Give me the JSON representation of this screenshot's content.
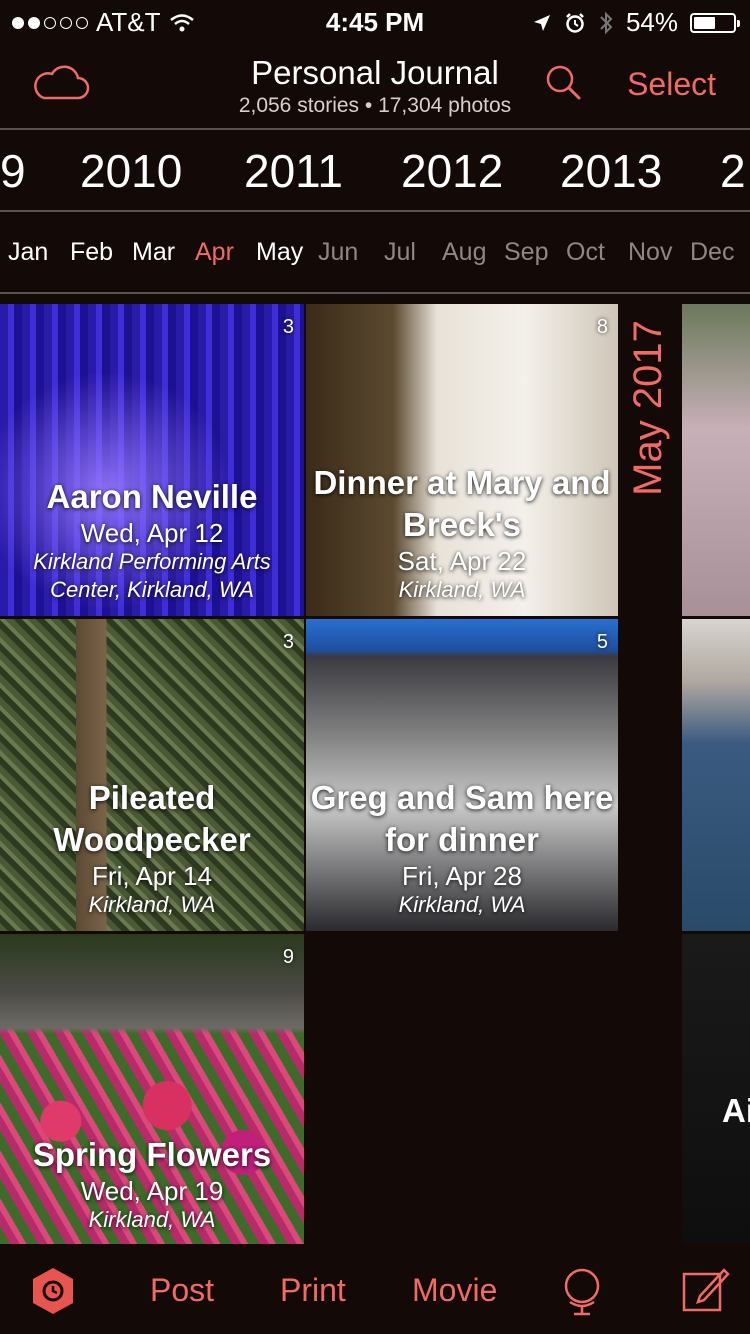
{
  "status": {
    "carrier": "AT&T",
    "time": "4:45 PM",
    "battery": "54%",
    "battery_level": 0.54,
    "signal_bars": 2
  },
  "header": {
    "title": "Personal Journal",
    "subtitle": "2,056 stories • 17,304 photos",
    "select_label": "Select"
  },
  "years": [
    "9",
    "2010",
    "2011",
    "2012",
    "2013",
    "2"
  ],
  "months": [
    "Jan",
    "Feb",
    "Mar",
    "Apr",
    "May",
    "Jun",
    "Jul",
    "Aug",
    "Sep",
    "Oct",
    "Nov",
    "Dec"
  ],
  "active_month": "Apr",
  "strip": {
    "month": "May",
    "year": "2017"
  },
  "stories": [
    {
      "title": "Aaron Neville",
      "date": "Wed, Apr 12",
      "location": "Kirkland Performing Arts Center, Kirkland, WA",
      "count": "3"
    },
    {
      "title": "Dinner at Mary and Breck's",
      "date": "Sat, Apr 22",
      "location": "Kirkland, WA",
      "count": "8"
    },
    {
      "title": "Pileated Woodpecker",
      "date": "Fri, Apr 14",
      "location": "Kirkland, WA",
      "count": "3"
    },
    {
      "title": "Greg and Sam here for dinner",
      "date": "Fri, Apr 28",
      "location": "Kirkland, WA",
      "count": "5"
    },
    {
      "title": "Spring Flowers",
      "date": "Wed, Apr 19",
      "location": "Kirkland, WA",
      "count": "9"
    }
  ],
  "right_partial": {
    "text": "Ai"
  },
  "tabs": {
    "post": "Post",
    "print": "Print",
    "movie": "Movie"
  },
  "colors": {
    "accent": "#f06b65",
    "background": "#130a07"
  },
  "icons": [
    "cloud-icon",
    "search-icon",
    "app-logo-icon",
    "globe-icon",
    "compose-icon",
    "location-arrow-icon",
    "alarm-icon",
    "bluetooth-icon",
    "wifi-icon"
  ]
}
